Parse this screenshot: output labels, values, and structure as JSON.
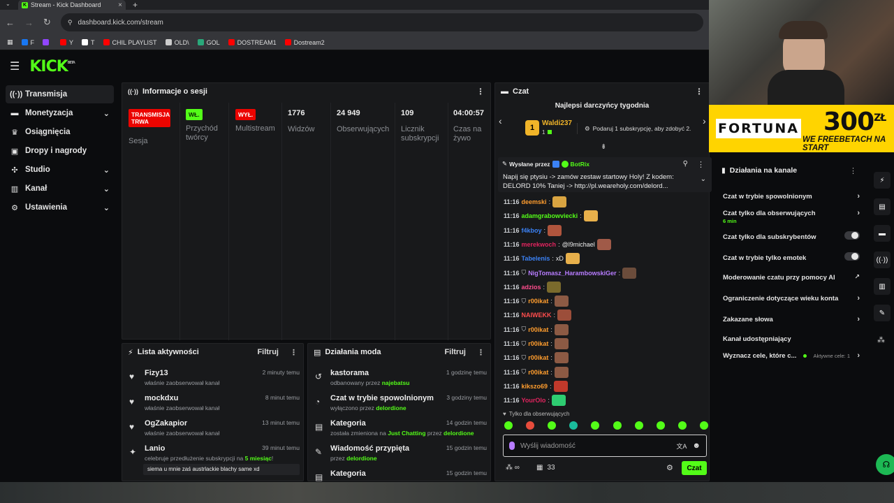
{
  "browser": {
    "tab_title": "Stream - Kick Dashboard",
    "url": "dashboard.kick.com/stream",
    "bookmarks": [
      {
        "label": "F",
        "color": "#1877f2"
      },
      {
        "label": "",
        "color": "#9146ff"
      },
      {
        "label": "Y",
        "color": "#ff0000"
      },
      {
        "label": "T",
        "color": "#ffffff"
      },
      {
        "label": "CHIL PLAYLIST",
        "color": "#ff0000"
      },
      {
        "label": "OLD\\",
        "color": "#cccccc"
      },
      {
        "label": "GOL",
        "color": "#2aa87a"
      },
      {
        "label": "DOSTREAM1",
        "color": "#ff0000"
      },
      {
        "label": "Dostream2",
        "color": "#ff0000"
      }
    ]
  },
  "header": {
    "logo": "KICK",
    "beta": "BETA"
  },
  "sidebar": {
    "items": [
      {
        "label": "Transmisja",
        "icon": "broadcast-icon",
        "glyph": "((·))"
      },
      {
        "label": "Monetyzacja",
        "icon": "money-icon",
        "glyph": "▬"
      },
      {
        "label": "Osiągnięcia",
        "icon": "trophy-icon",
        "glyph": "♛"
      },
      {
        "label": "Dropy i nagrody",
        "icon": "gift-icon",
        "glyph": "▣"
      },
      {
        "label": "Studio",
        "icon": "studio-icon",
        "glyph": "✣"
      },
      {
        "label": "Kanał",
        "icon": "channel-icon",
        "glyph": "▥"
      },
      {
        "label": "Ustawienia",
        "icon": "gear-icon",
        "glyph": "⚙"
      }
    ]
  },
  "session": {
    "title": "Informacje o sesji",
    "stats": [
      {
        "badge": "TRANSMISJA TRWA",
        "badge_color": "#eb0400",
        "label": "Sesja"
      },
      {
        "badge": "WŁ.",
        "badge_color": "#53fc18",
        "label": "Przychód twórcy"
      },
      {
        "badge": "WYŁ.",
        "badge_color": "#eb0400",
        "label": "Multistream"
      },
      {
        "value": "1776",
        "label": "Widzów"
      },
      {
        "value": "24 949",
        "label": "Obserwujących"
      },
      {
        "value": "109",
        "label": "Licznik subskrypcji"
      },
      {
        "value": "04:00:57",
        "label": "Czas na żywo"
      }
    ]
  },
  "activity": {
    "title": "Lista aktywności",
    "filter": "Filtruj",
    "items": [
      {
        "name": "Fizy13",
        "sub": "właśnie zaobserwował kanał",
        "time": "2 minuty temu",
        "icon": "heart-icon"
      },
      {
        "name": "mockdxu",
        "sub": "właśnie zaobserwował kanał",
        "time": "8 minut temu",
        "icon": "heart-icon"
      },
      {
        "name": "OgZakapior",
        "sub": "właśnie zaobserwował kanał",
        "time": "13 minut temu",
        "icon": "heart-icon"
      },
      {
        "name": "Lanio",
        "sub_prefix": "celebruje przedłużenie subskrypcji na ",
        "sub_highlight": "5 miesiąc",
        "sub_suffix": "!",
        "time": "39 minut temu",
        "icon": "star-icon",
        "quote": "siema u mnie zaś austrlackie blachy same xd"
      }
    ]
  },
  "mod": {
    "title": "Działania moda",
    "filter": "Filtruj",
    "items": [
      {
        "name": "kastorama",
        "sub_prefix": "odbanowany przez ",
        "sub_user": "najebatsu",
        "time": "1 godzinę temu",
        "icon": "unban-icon"
      },
      {
        "name": "Czat w trybie spowolnionym",
        "sub_prefix": "wyłączono przez ",
        "sub_user": "delordione",
        "time": "3 godziny temu",
        "icon": "slow-mode-icon"
      },
      {
        "name": "Kategoria",
        "sub_prefix": "została zmieniona na ",
        "sub_user": "Just Chatting",
        "sub_mid": " przez ",
        "sub_user2": "delordione",
        "time": "14 godzin temu",
        "icon": "category-icon"
      },
      {
        "name": "Wiadomość przypięta",
        "sub_prefix": "przez ",
        "sub_user": "delordione",
        "time": "15 godzin temu",
        "icon": "pin-icon"
      },
      {
        "name": "Kategoria",
        "time": "15 godzin temu",
        "icon": "category-icon"
      }
    ]
  },
  "chat": {
    "title": "Czat",
    "top_donors_title": "Najlepsi darczyńcy tygodnia",
    "top_donor": {
      "name": "Waldi237",
      "count": "1",
      "rank": "1"
    },
    "gift_prompt": "Podaruj 1 subskrypcję, aby zdobyć 2.",
    "pinned": {
      "sent_by": "Wysłane przez",
      "author": "BotRix",
      "text": "Napij się ptysiu -> zamów zestaw startowy Holy! Z kodem: DELORD 10% Taniej -> http://pl.weareholy.com/delord..."
    },
    "messages": [
      {
        "time": "11:16",
        "user": "deemski",
        "color": "#ff9d2e",
        "text": "",
        "emote": "#d9a441"
      },
      {
        "time": "11:16",
        "user": "adamgrabowviecki",
        "color": "#53fc18",
        "text": "",
        "emote": "#e8b04b"
      },
      {
        "time": "11:16",
        "user": "f4kboy",
        "color": "#3b82f6",
        "text": "",
        "emote": "#b0553d"
      },
      {
        "time": "11:16",
        "user": "merekwoch",
        "color": "#e0245e",
        "text": "@l9michael",
        "emote": "#a05a48"
      },
      {
        "time": "11:16",
        "user": "Tabelenis",
        "color": "#3b82f6",
        "text": "xD",
        "emote": "#e8b04b"
      },
      {
        "time": "11:16",
        "user": "NigTomasz_HarambowskiGer",
        "color": "#b77cff",
        "text": "",
        "emote": "#6b4c3b",
        "shield": true
      },
      {
        "time": "11:16",
        "user": "adzios",
        "color": "#ff4d8d",
        "text": "",
        "emote": "#7a6a2c"
      },
      {
        "time": "11:16",
        "user": "r00ikat",
        "color": "#ff9d2e",
        "text": "",
        "emote": "#8c5a44",
        "shield": true
      },
      {
        "time": "11:16",
        "user": "NAIWEKK",
        "color": "#ff4d4d",
        "text": "",
        "emote": "#9c4e3a"
      },
      {
        "time": "11:16",
        "user": "r00ikat",
        "color": "#ff9d2e",
        "text": "",
        "emote": "#8c5a44",
        "shield": true
      },
      {
        "time": "11:16",
        "user": "r00ikat",
        "color": "#ff9d2e",
        "text": "",
        "emote": "#8c5a44",
        "shield": true
      },
      {
        "time": "11:16",
        "user": "r00ikat",
        "color": "#ff9d2e",
        "text": "",
        "emote": "#8c5a44",
        "shield": true
      },
      {
        "time": "11:16",
        "user": "r00ikat",
        "color": "#ff9d2e",
        "text": "",
        "emote": "#8c5a44",
        "shield": true
      },
      {
        "time": "11:16",
        "user": "kikszo69",
        "color": "#ff9d2e",
        "text": "",
        "emote": "#c0392b"
      },
      {
        "time": "11:16",
        "user": "YourOlo",
        "color": "#e0245e",
        "text": "",
        "emote": "#2ecc71"
      }
    ],
    "followers_only": "Tylko dla obserwujących",
    "emote_colors": [
      "#53fc18",
      "#e74c3c",
      "#53fc18",
      "#1abc9c",
      "#53fc18",
      "#53fc18",
      "#53fc18",
      "#53fc18",
      "#53fc18",
      "#53fc18"
    ],
    "input_placeholder": "Wyślij wiadomość",
    "viewers": "33",
    "send_label": "Czat"
  },
  "ad": {
    "brand": "FORTUNA",
    "amount": "300",
    "currency": "ZŁ",
    "tagline": "WE FREEBETACH NA START"
  },
  "channel": {
    "title": "Działania na kanale",
    "items": [
      {
        "label": "Czat w trybie spowolnionym",
        "control": "chevron"
      },
      {
        "label": "Czat tylko dla obserwujących",
        "sub": "6 min",
        "control": "chevron"
      },
      {
        "label": "Czat tylko dla subskrybentów",
        "control": "toggle"
      },
      {
        "label": "Czat w trybie tylko emotek",
        "control": "toggle"
      },
      {
        "label": "Moderowanie czatu przy pomocy AI",
        "control": "link"
      },
      {
        "label": "Ograniczenie dotyczące wieku konta",
        "control": "chevron"
      },
      {
        "label": "Zakazane słowa",
        "control": "chevron"
      },
      {
        "label": "Kanał udostępniający",
        "control": "none"
      },
      {
        "label": "Wyznacz cele, które c...",
        "goal": "Aktywne cele: 1",
        "control": "chevron"
      }
    ]
  }
}
